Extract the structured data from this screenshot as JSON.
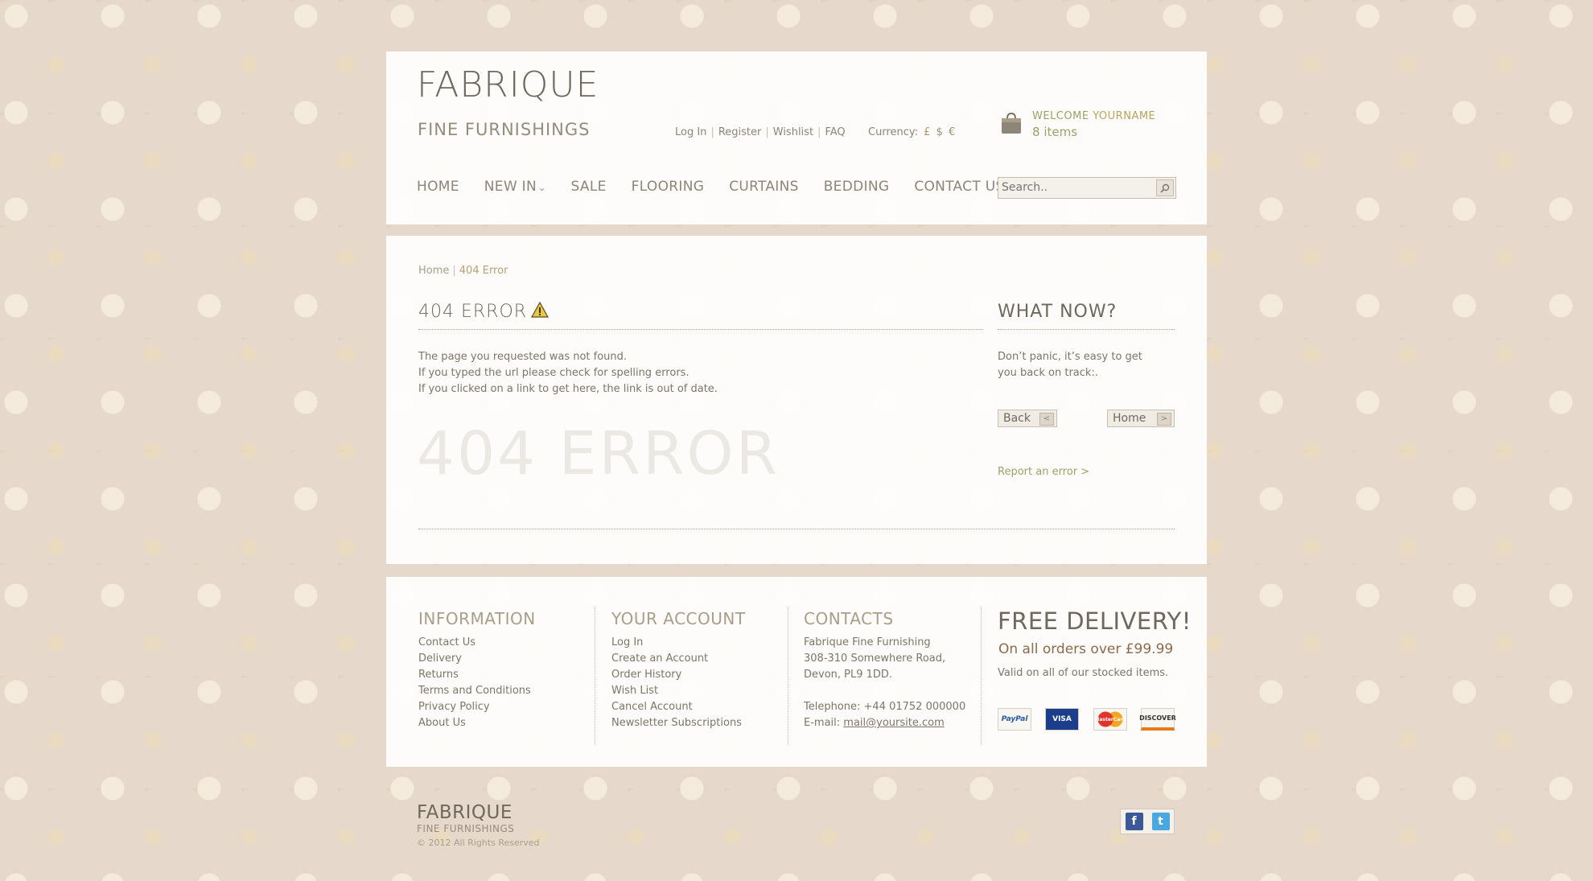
{
  "header": {
    "logo_title": "FABRIQUE",
    "logo_sub": "FINE FURNISHINGS",
    "top_links": [
      "Log In",
      "Register",
      "Wishlist",
      "FAQ"
    ],
    "currency_label": "Currency:",
    "currencies": [
      "£",
      "$",
      "€"
    ],
    "welcome_prefix": "WELCOME",
    "welcome_name": "YOURNAME",
    "cart_count": "8",
    "cart_items_label": "items",
    "search_placeholder": "Search..",
    "nav": [
      "HOME",
      "NEW IN",
      "SALE",
      "FLOORING",
      "CURTAINS",
      "BEDDING",
      "CONTACT US"
    ]
  },
  "main": {
    "breadcrumb_home": "Home",
    "breadcrumb_current": "404 Error",
    "title": "404 ERROR",
    "messages": [
      "The page you requested was not found.",
      "If you typed the url please check for spelling errors.",
      "If you clicked on a link to get here, the link is out of date."
    ],
    "ghost_text": "404 ERROR",
    "side_title": "WHAT NOW?",
    "side_text": "Don’t panic, it’s easy to get you back on track:.",
    "back_label": "Back",
    "home_label": "Home",
    "report_label": "Report an error >"
  },
  "footer": {
    "information": {
      "title": "INFORMATION",
      "links": [
        "Contact Us",
        "Delivery",
        "Returns",
        "Terms and Conditions",
        "Privacy Policy",
        "About Us"
      ]
    },
    "account": {
      "title": "YOUR ACCOUNT",
      "links": [
        "Log In",
        "Create an Account",
        "Order History",
        "Wish List",
        "Cancel Account",
        "Newsletter Subscriptions"
      ]
    },
    "contacts": {
      "title": "CONTACTS",
      "company": "Fabrique Fine Furnishing",
      "address1": "308-310 Somewhere Road,",
      "address2": "Devon,  PL9 1DD.",
      "telephone": "Telephone: +44 01752 000000",
      "email_label": "E-mail:",
      "email": "mail@yoursite.com"
    },
    "delivery": {
      "title": "FREE DELIVERY!",
      "subtitle": "On all orders over £99.99",
      "note": "Valid on all of our stocked items.",
      "cards": [
        "PayPal",
        "VISA",
        "MasterCard",
        "DISCOVER"
      ]
    },
    "bottom_logo": "FABRIQUE",
    "bottom_sub": "FINE FURNISHINGS",
    "copyright": "© 2012 All Rights Reserved",
    "social": [
      "facebook-icon",
      "twitter-icon"
    ]
  }
}
